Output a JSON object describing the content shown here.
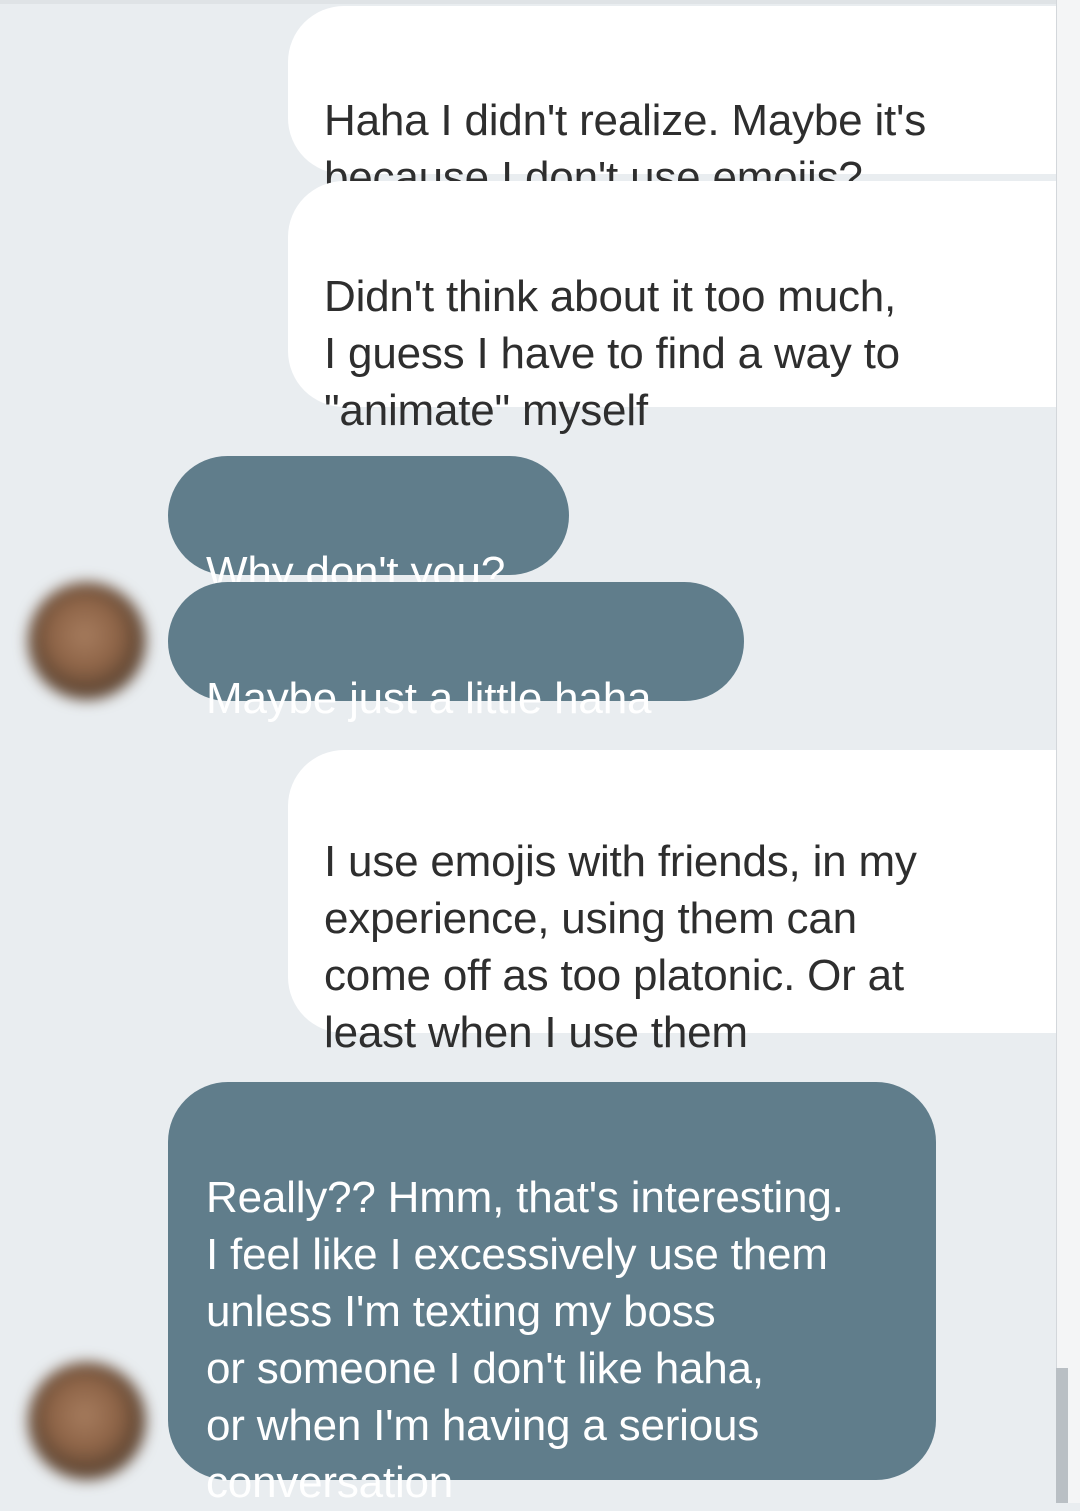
{
  "messages": [
    {
      "direction": "outgoing",
      "text": "Haha I didn't realize. Maybe it's\nbecause I don't use emojis?"
    },
    {
      "direction": "outgoing",
      "text": "Didn't think about it too much,\nI guess I have to find a way to\n\"animate\" myself"
    },
    {
      "direction": "incoming",
      "text": "Why don't you?"
    },
    {
      "direction": "incoming",
      "text": "Maybe just a little haha"
    },
    {
      "direction": "outgoing",
      "text": "I use emojis with friends, in my\nexperience, using them can\ncome off as too platonic. Or at\nleast when I use them"
    },
    {
      "direction": "incoming",
      "text": "Really?? Hmm, that's interesting.\nI feel like I excessively use them\nunless I'm texting my boss\nor someone I don't like haha,\nor when I'm having a serious\nconversation"
    }
  ],
  "colors": {
    "background": "#e9edf0",
    "outgoing_bubble": "#ffffff",
    "incoming_bubble": "#607d8b",
    "outgoing_text": "#2e2e2e",
    "incoming_text": "#ffffff"
  }
}
